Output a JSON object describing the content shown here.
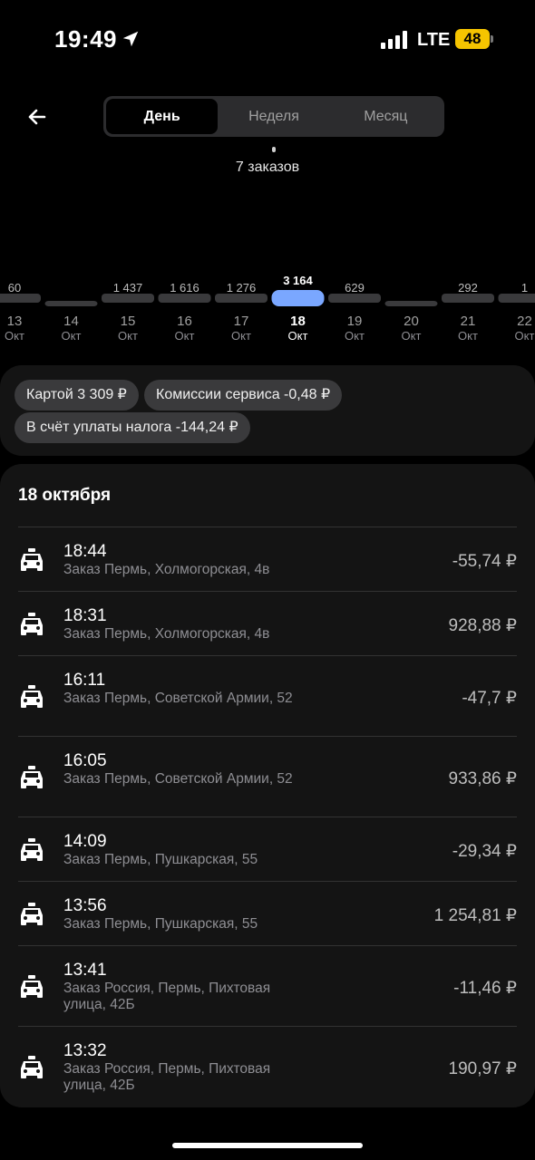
{
  "status_bar": {
    "time": "19:49",
    "network": "LTE",
    "battery": "48"
  },
  "header": {
    "tabs": [
      {
        "label": "День",
        "active": true
      },
      {
        "label": "Неделя",
        "active": false
      },
      {
        "label": "Месяц",
        "active": false
      }
    ],
    "orders_count": "7 заказов"
  },
  "chart_data": {
    "type": "bar",
    "categories": [
      "13",
      "14",
      "15",
      "16",
      "17",
      "18",
      "19",
      "20",
      "21",
      "22"
    ],
    "month_labels": [
      "Окт",
      "Окт",
      "Окт",
      "Окт",
      "Окт",
      "Окт",
      "Окт",
      "Окт",
      "Окт",
      "Окт"
    ],
    "value_labels": [
      "60",
      "",
      "1 437",
      "1 616",
      "1 276",
      "3 164",
      "629",
      "",
      "292",
      "1"
    ],
    "values": [
      60,
      0,
      1437,
      1616,
      1276,
      3164,
      629,
      0,
      292,
      1
    ],
    "selected_index": 5,
    "accent_color": "#7aa7ff",
    "bar_color": "#3a3a3c"
  },
  "summary_chips": [
    {
      "label": "Картой 3 309 ₽"
    },
    {
      "label": "Комиссии сервиса -0,48 ₽"
    },
    {
      "label": "В счёт уплаты налога -144,24 ₽"
    }
  ],
  "orders": {
    "date_title": "18 октября",
    "items": [
      {
        "time": "18:44",
        "address": "Заказ Пермь, Холмогорская, 4в",
        "amount": "-55,74 ₽",
        "icon": "taxi-car-icon"
      },
      {
        "time": "18:31",
        "address": "Заказ Пермь, Холмогорская, 4в",
        "amount": "928,88 ₽",
        "icon": "taxi-car-icon"
      },
      {
        "time": "16:11",
        "address": "Заказ Пермь, Советской Армии, 52",
        "amount": "-47,7 ₽",
        "icon": "taxi-car-icon"
      },
      {
        "time": "16:05",
        "address": "Заказ Пермь, Советской Армии, 52",
        "amount": "933,86 ₽",
        "icon": "taxi-car-icon"
      },
      {
        "time": "14:09",
        "address": "Заказ Пермь, Пушкарская, 55",
        "amount": "-29,34 ₽",
        "icon": "taxi-car-icon"
      },
      {
        "time": "13:56",
        "address": "Заказ Пермь, Пушкарская, 55",
        "amount": "1 254,81 ₽",
        "icon": "taxi-car-icon"
      },
      {
        "time": "13:41",
        "address": "Заказ Россия, Пермь, Пихтовая улица, 42Б",
        "amount": "-11,46 ₽",
        "icon": "taxi-car-icon"
      },
      {
        "time": "13:32",
        "address": "Заказ Россия, Пермь, Пихтовая улица, 42Б",
        "amount": "190,97 ₽",
        "icon": "taxi-car-icon"
      }
    ]
  }
}
